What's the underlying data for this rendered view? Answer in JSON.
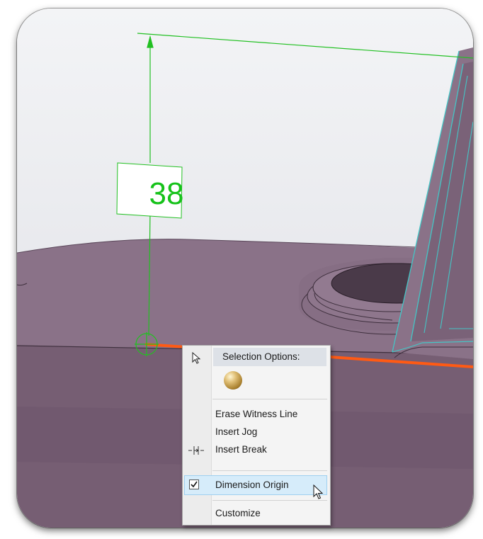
{
  "dimension": {
    "value": "38"
  },
  "context_menu": {
    "header": "Selection Options:",
    "items": [
      {
        "label": "Erase Witness Line"
      },
      {
        "label": "Insert Jog"
      },
      {
        "label": "Insert Break"
      },
      {
        "label": "Dimension Origin",
        "checked": true
      },
      {
        "label": "Customize"
      }
    ]
  },
  "colors": {
    "part_top": "#8a7288",
    "part_side": "#765e73",
    "dimension_green": "#16c21a",
    "selected_edge": "#ff5a14",
    "menu_highlight": "#d6ecfa"
  },
  "icons": [
    "arrow-cursor-icon",
    "gold-sphere-icon",
    "insert-break-icon",
    "checkbox-icon",
    "mouse-pointer-icon"
  ]
}
